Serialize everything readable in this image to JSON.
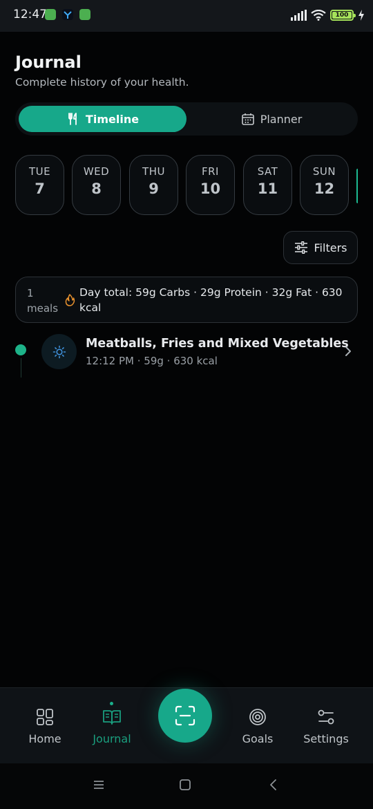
{
  "status_bar": {
    "time": "12:47",
    "battery": "100"
  },
  "header": {
    "title": "Journal",
    "subtitle": "Complete history of your health."
  },
  "view_toggle": {
    "timeline_label": "Timeline",
    "planner_label": "Planner",
    "active": "Timeline"
  },
  "days": [
    {
      "name": "TUE",
      "num": "7"
    },
    {
      "name": "WED",
      "num": "8"
    },
    {
      "name": "THU",
      "num": "9"
    },
    {
      "name": "FRI",
      "num": "10"
    },
    {
      "name": "SAT",
      "num": "11"
    },
    {
      "name": "SUN",
      "num": "12"
    }
  ],
  "filters_label": "Filters",
  "day_total": {
    "meal_count": "1",
    "meal_unit": "meals",
    "text": "Day total: 59g Carbs · 29g Protein · 32g Fat · 630 kcal"
  },
  "meals": [
    {
      "name": "Meatballs, Fries and Mixed Vegetables",
      "meta": "12:12 PM · 59g · 630 kcal"
    }
  ],
  "nav": {
    "home": "Home",
    "journal": "Journal",
    "goals": "Goals",
    "settings": "Settings",
    "active": "Journal"
  },
  "colors": {
    "accent": "#17a88a",
    "background": "#030405",
    "battery": "#a6e35a"
  }
}
